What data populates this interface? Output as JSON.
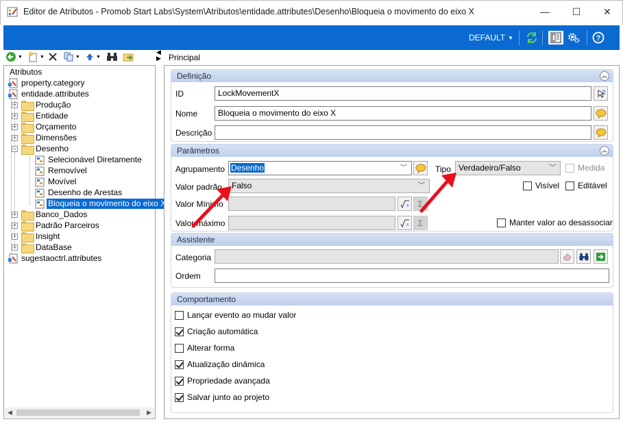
{
  "window": {
    "title": "Editor de Atributos - Promob Start Labs\\System\\Atributos\\entidade.attributes\\Desenho\\Bloqueia o movimento do eixo X",
    "minimize": "—",
    "maximize": "☐",
    "close": "✕"
  },
  "toolbar": {
    "profile_label": "DEFAULT",
    "refresh_icon": "refresh-icon",
    "layout_icon": "layout-icon",
    "settings_icon": "gear-icon",
    "help_icon": "help-icon",
    "accent_color": "#0a6ad1"
  },
  "tree": {
    "items": [
      {
        "label": "Atributos"
      },
      {
        "label": "property.category"
      },
      {
        "label": "entidade.attributes"
      },
      {
        "label": "Produção"
      },
      {
        "label": "Entidade"
      },
      {
        "label": "Orçamento"
      },
      {
        "label": "Dimensões"
      },
      {
        "label": "Desenho"
      },
      {
        "label": "Selecionável Diretamente"
      },
      {
        "label": "Removível"
      },
      {
        "label": "Movível"
      },
      {
        "label": "Desenho de Arestas"
      },
      {
        "label": "Bloqueia o movimento do eixo X"
      },
      {
        "label": "Banco_Dados"
      },
      {
        "label": "Padrão Parceiros"
      },
      {
        "label": "Insight"
      },
      {
        "label": "DataBase"
      },
      {
        "label": "sugestaoctrl.attributes"
      }
    ],
    "selected": "Bloqueia o movimento do eixo X"
  },
  "main": {
    "tab_label": "Principal",
    "definicao": {
      "header": "Definição",
      "id_label": "ID",
      "id_value": "LockMovementX",
      "nome_label": "Nome",
      "nome_value": "Bloqueia o movimento do eixo X",
      "descricao_label": "Descrição",
      "descricao_value": ""
    },
    "parametros": {
      "header": "Parâmetros",
      "agrupamento_label": "Agrupamento",
      "agrupamento_value": "Desenho",
      "tipo_label": "Tipo",
      "tipo_value": "Verdadeiro/Falso",
      "medida_label": "Medida",
      "medida_checked": false,
      "valor_padrao_label": "Valor padrão",
      "valor_padrao_value": "Falso",
      "visivel_label": "Visível",
      "visivel_checked": false,
      "editavel_label": "Editável",
      "editavel_checked": false,
      "valor_minimo_label": "Valor Mínimo",
      "valor_maximo_label": "Valor máximo",
      "manter_label": "Manter valor ao desassociar",
      "manter_checked": false
    },
    "assistente": {
      "header": "Assistente",
      "categoria_label": "Categoria",
      "categoria_value": "",
      "ordem_label": "Ordem",
      "ordem_value": ""
    },
    "comportamento": {
      "header": "Comportamento",
      "options": [
        {
          "label": "Lançar evento ao mudar valor",
          "checked": false
        },
        {
          "label": "Criação automática",
          "checked": true
        },
        {
          "label": "Alterar forma",
          "checked": false
        },
        {
          "label": "Atualização dinâmica",
          "checked": true
        },
        {
          "label": "Propriedade avançada",
          "checked": true
        },
        {
          "label": "Salvar junto ao projeto",
          "checked": true
        }
      ]
    }
  },
  "annotations": {
    "arrow_color": "#e8101e"
  }
}
